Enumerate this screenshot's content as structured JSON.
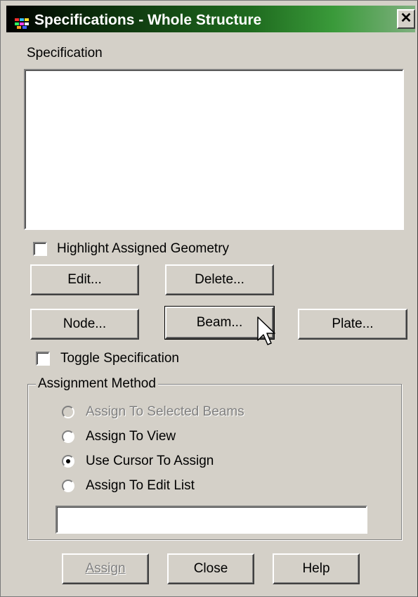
{
  "window": {
    "title": "Specifications - Whole Structure",
    "close_glyph": "✕"
  },
  "specification": {
    "label": "Specification",
    "items": []
  },
  "highlight_checkbox": {
    "label": "Highlight Assigned Geometry",
    "checked": false
  },
  "buttons": {
    "edit": "Edit...",
    "delete": "Delete...",
    "node": "Node...",
    "beam": "Beam...",
    "plate": "Plate..."
  },
  "toggle_checkbox": {
    "label": "Toggle Specification",
    "checked": false
  },
  "assignment_method": {
    "label": "Assignment Method",
    "options": [
      {
        "label": "Assign To Selected Beams",
        "selected": false,
        "enabled": false
      },
      {
        "label": "Assign To View",
        "selected": false,
        "enabled": true
      },
      {
        "label": "Use Cursor To Assign",
        "selected": true,
        "enabled": true
      },
      {
        "label": "Assign To Edit List",
        "selected": false,
        "enabled": true
      }
    ],
    "edit_list_value": ""
  },
  "footer": {
    "assign": "Assign",
    "close": "Close",
    "help": "Help"
  },
  "icons": {
    "app": "staad-app-icon",
    "cursor": "mouse-pointer-icon"
  },
  "colors": {
    "titlebar_start": "#000000",
    "titlebar_end": "#7fb07f",
    "face": "#d4d0c8"
  }
}
